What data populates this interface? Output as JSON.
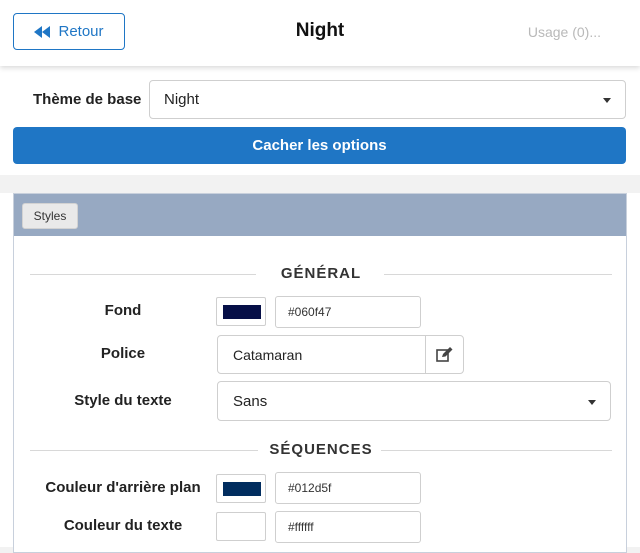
{
  "header": {
    "back_label": "Retour",
    "title": "Night",
    "usage": "Usage (0)..."
  },
  "theme": {
    "label": "Thème de base",
    "value": "Night"
  },
  "options_toggle_label": "Cacher les options",
  "panel": {
    "tab_label": "Styles",
    "sections": {
      "general": {
        "title": "GÉNÉRAL",
        "background": {
          "label": "Fond",
          "color": "#060f47",
          "hex": "#060f47"
        },
        "font": {
          "label": "Police",
          "value": "Catamaran"
        },
        "text_style": {
          "label": "Style du texte",
          "value": "Sans"
        }
      },
      "sequences": {
        "title": "SÉQUENCES",
        "bg_color": {
          "label": "Couleur d'arrière plan",
          "color": "#012d5f",
          "hex": "#012d5f"
        },
        "text_color": {
          "label": "Couleur du texte",
          "color": "#ffffff",
          "hex": "#ffffff"
        }
      }
    }
  },
  "icons": {
    "back": "double-left-arrow-icon",
    "edit": "edit-icon",
    "caret": "chevron-down-icon"
  },
  "colors": {
    "primary": "#1f76c5",
    "panel_header": "#97a9c2"
  }
}
